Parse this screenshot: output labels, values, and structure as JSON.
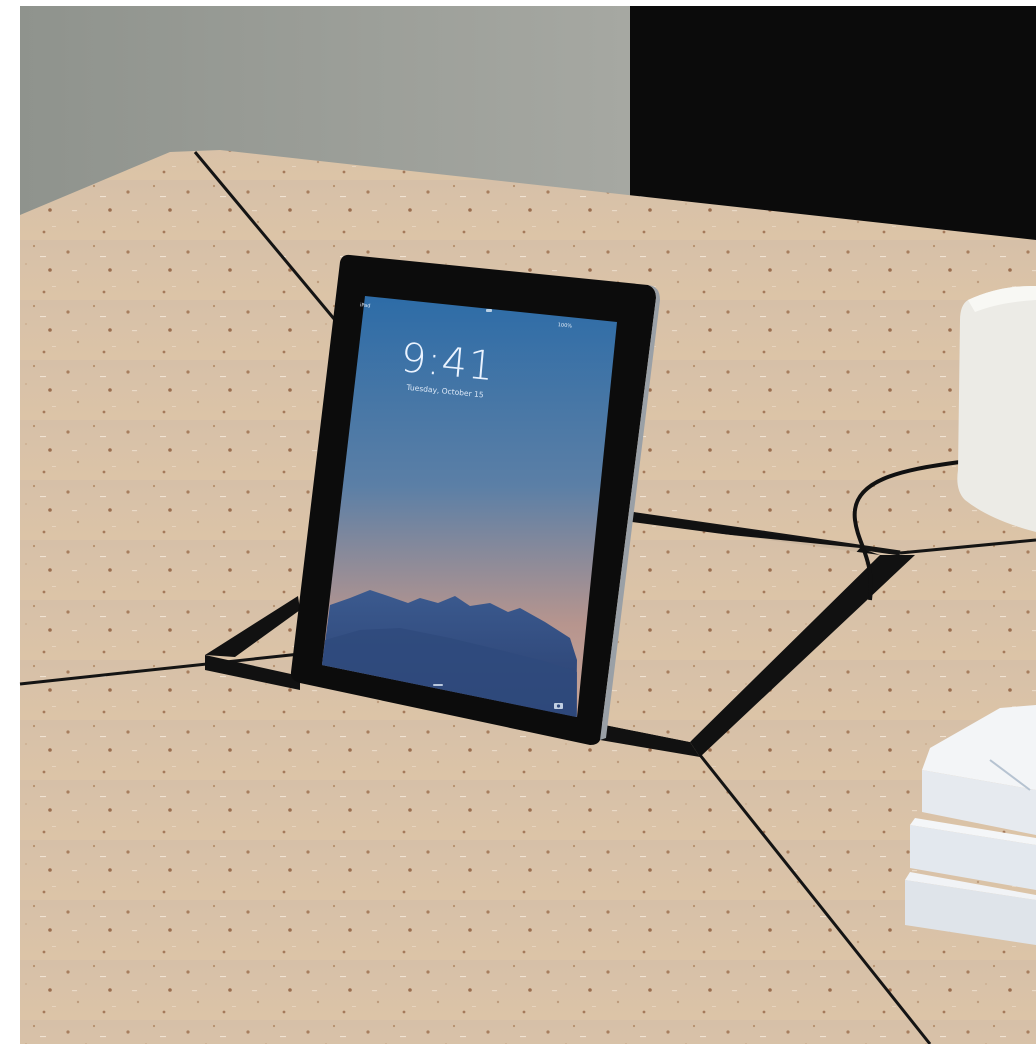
{
  "lock_screen": {
    "time": "9:41",
    "date": "Tuesday, October 15",
    "status_carrier": "iPad",
    "status_lock": "",
    "status_battery": "100%",
    "home_indicator": "",
    "camera_glyph": "camera-icon"
  },
  "scene_parts": {
    "background_wall": "gray wall",
    "background_dark": "black panel",
    "table": "particle board table",
    "device": "tablet",
    "accessory": "white box",
    "papers": "stack of cards"
  },
  "colors": {
    "wall": "#9a9d98",
    "dark_panel": "#0b0b0b",
    "table": "#d9c1a6",
    "seam": "#111111",
    "screen_top": "#2f6ea6",
    "screen_bottom": "#c9a593",
    "bezel": "#0c0c0c"
  }
}
